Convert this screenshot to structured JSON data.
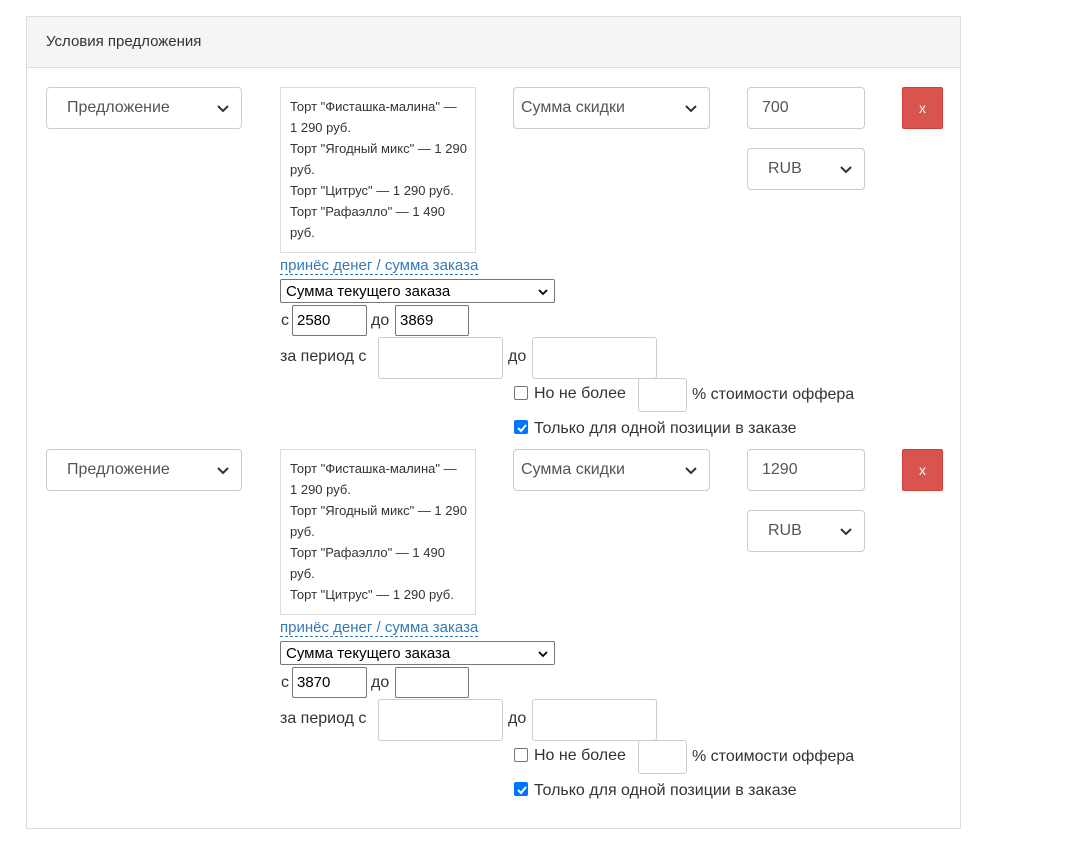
{
  "panel": {
    "title": "Условия предложения"
  },
  "rows": [
    {
      "type_select": "Предложение",
      "items": [
        "Торт \"Фисташка-малина\" — 1 290 руб.",
        "Торт \"Ягодный микс\" — 1 290 руб.",
        "Торт \"Цитрус\" — 1 290 руб.",
        "Торт \"Рафаэлло\" — 1 490 руб."
      ],
      "discount_type": "Сумма скидки",
      "discount_value": "700",
      "currency": "RUB",
      "remove_label": "x",
      "toggle_link": "принёс денег / сумма заказа",
      "amount_select": "Сумма текущего заказа",
      "from_label": "с",
      "from_value": "2580",
      "to_label": "до",
      "to_value": "3869",
      "period_label": "за период с",
      "period_to_label": "до",
      "max_label": "Но не более",
      "max_suffix": "% стоимости оффера",
      "max_checked": false,
      "single_label": "Только для одной позиции в заказе",
      "single_checked": true
    },
    {
      "type_select": "Предложение",
      "items": [
        "Торт \"Фисташка-малина\" — 1 290 руб.",
        "Торт \"Ягодный микс\" — 1 290 руб.",
        "Торт \"Рафаэлло\" — 1 490 руб.",
        "Торт \"Цитрус\" — 1 290 руб."
      ],
      "discount_type": "Сумма скидки",
      "discount_value": "1290",
      "currency": "RUB",
      "remove_label": "x",
      "toggle_link": "принёс денег / сумма заказа",
      "amount_select": "Сумма текущего заказа",
      "from_label": "с",
      "from_value": "3870",
      "to_label": "до",
      "to_value": "",
      "period_label": "за период с",
      "period_to_label": "до",
      "max_label": "Но не более",
      "max_suffix": "% стоимости оффера",
      "max_checked": false,
      "single_label": "Только для одной позиции в заказе",
      "single_checked": true
    }
  ],
  "colors": {
    "danger": "#d9534f",
    "link": "#337ab7",
    "checkbox": "#0075ff"
  }
}
